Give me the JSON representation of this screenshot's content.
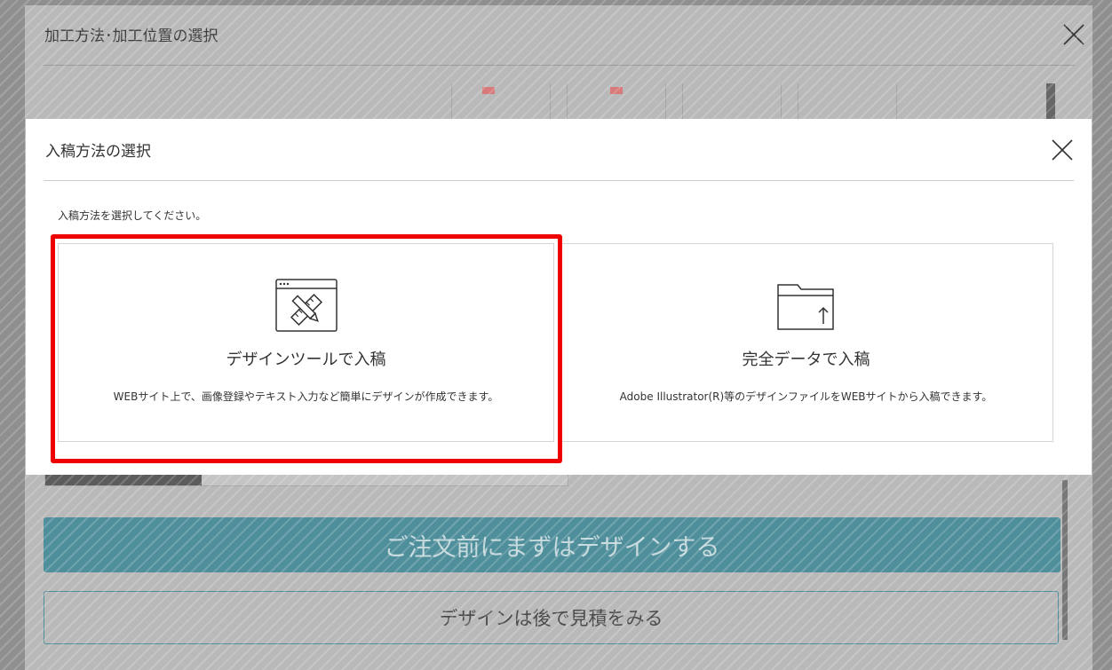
{
  "outer_dialog": {
    "title": "加工方法･加工位置の選択",
    "primary_button": "ご注文前にまずはデザインする",
    "secondary_button": "デザインは後で見積をみる"
  },
  "modal": {
    "title": "入稿方法の選択",
    "instruction": "入稿方法を選択してください。",
    "options": [
      {
        "title": "デザインツールで入稿",
        "description": "WEBサイト上で、画像登録やテキスト入力など簡単にデザインが作成できます。",
        "icon": "design-tool-icon"
      },
      {
        "title": "完全データで入稿",
        "description": "Adobe Illustrator(R)等のデザインファイルをWEBサイトから入稿できます。",
        "icon": "folder-upload-icon"
      }
    ]
  },
  "colors": {
    "highlight": "#ee0000",
    "accent": "#4f8f9b"
  }
}
